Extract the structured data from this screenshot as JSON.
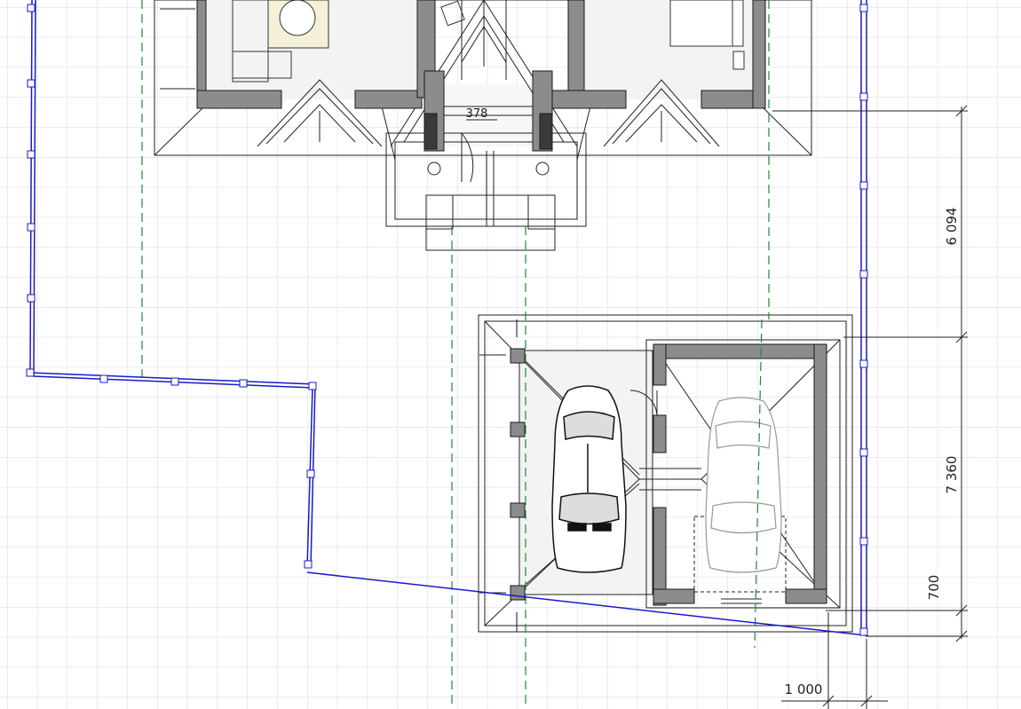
{
  "dimensions": {
    "house_to_garage": "6 094",
    "garage_depth": "7 360",
    "garage_offset": "700",
    "door_width": "378",
    "setback": "1 000"
  },
  "colors": {
    "grid": "#d9d9d9",
    "wall_fill": "#8c8c8c",
    "wall_outline": "#1a1a1a",
    "boundary": "#1a1acc",
    "axis_dash": "#1e8a2e",
    "line": "#222222",
    "floor": "#f3f3f3"
  },
  "icons": [
    "car-icon",
    "armchair-icon",
    "bed-icon",
    "round-table-icon",
    "post-marker-icon"
  ]
}
